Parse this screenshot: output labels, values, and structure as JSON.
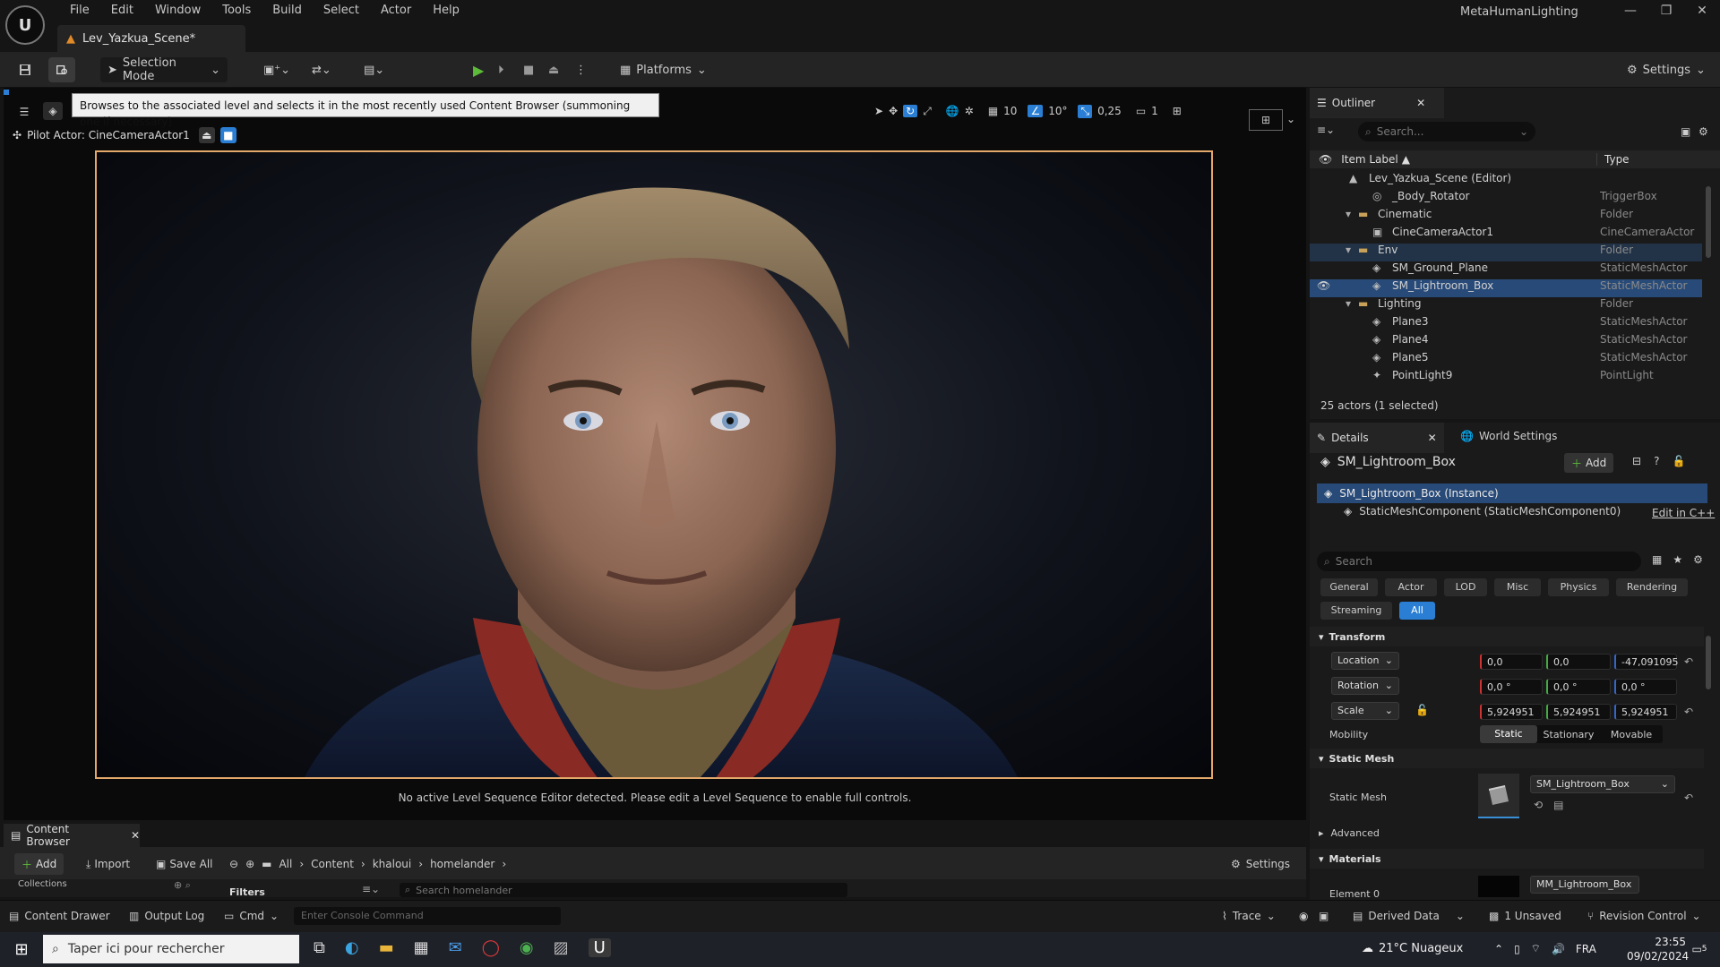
{
  "menu": [
    "File",
    "Edit",
    "Window",
    "Tools",
    "Build",
    "Select",
    "Actor",
    "Help"
  ],
  "doc_tab": "Lev_Yazkua_Scene*",
  "project_name": "MetaHumanLighting",
  "toolbar": {
    "selection_mode": "Selection Mode",
    "platforms": "Platforms",
    "settings": "Settings"
  },
  "viewport": {
    "tooltip": "Browses to the associated level and selects it in the most recently used Content Browser (summoning one if necessary)",
    "pilot_actor": "Pilot Actor: CineCameraActor1",
    "grid_snap": "10",
    "angle_snap": "10°",
    "scale_snap": "0,25",
    "camera_speed": "1",
    "sequencer_msg": "No active Level Sequence Editor detected. Please edit a Level Sequence to enable full controls."
  },
  "outliner": {
    "title": "Outliner",
    "search_placeholder": "Search...",
    "col_label": "Item Label",
    "col_type": "Type",
    "rows": [
      {
        "name": "Lev_Yazkua_Scene (Editor)",
        "type": ""
      },
      {
        "name": "_Body_Rotator",
        "type": "TriggerBox"
      },
      {
        "name": "Cinematic",
        "type": "Folder"
      },
      {
        "name": "CineCameraActor1",
        "type": "CineCameraActor"
      },
      {
        "name": "Env",
        "type": "Folder"
      },
      {
        "name": "SM_Ground_Plane",
        "type": "StaticMeshActor"
      },
      {
        "name": "SM_Lightroom_Box",
        "type": "StaticMeshActor"
      },
      {
        "name": "Lighting",
        "type": "Folder"
      },
      {
        "name": "Plane3",
        "type": "StaticMeshActor"
      },
      {
        "name": "Plane4",
        "type": "StaticMeshActor"
      },
      {
        "name": "Plane5",
        "type": "StaticMeshActor"
      },
      {
        "name": "PointLight9",
        "type": "PointLight"
      }
    ],
    "footer": "25 actors (1 selected)"
  },
  "details": {
    "tab": "Details",
    "world_tab": "World Settings",
    "actor_name": "SM_Lightroom_Box",
    "add_label": "Add",
    "instance": "SM_Lightroom_Box (Instance)",
    "component": "StaticMeshComponent (StaticMeshComponent0)",
    "edit_cpp": "Edit in C++",
    "search_placeholder": "Search",
    "filters": [
      "General",
      "Actor",
      "LOD",
      "Misc",
      "Physics",
      "Rendering",
      "Streaming",
      "All"
    ],
    "transform_header": "Transform",
    "location_label": "Location",
    "location": [
      "0,0",
      "0,0",
      "-47,091095"
    ],
    "rotation_label": "Rotation",
    "rotation": [
      "0,0 °",
      "0,0 °",
      "0,0 °"
    ],
    "scale_label": "Scale",
    "scale": [
      "5,924951",
      "5,924951",
      "5,924951"
    ],
    "mobility_label": "Mobility",
    "mobility": [
      "Static",
      "Stationary",
      "Movable"
    ],
    "static_mesh_header": "Static Mesh",
    "static_mesh_label": "Static Mesh",
    "static_mesh_value": "SM_Lightroom_Box",
    "advanced": "Advanced",
    "materials_header": "Materials",
    "element0": "Element 0",
    "material_value": "MM_Lightroom_Box"
  },
  "content_browser": {
    "tab": "Content Browser",
    "add": "Add",
    "import": "Import",
    "save_all": "Save All",
    "path": [
      "All",
      "Content",
      "khaloui",
      "homelander"
    ],
    "settings": "Settings",
    "collections": "Collections",
    "filters": "Filters",
    "search_placeholder": "Search homelander"
  },
  "statusbar": {
    "content_drawer": "Content Drawer",
    "output_log": "Output Log",
    "cmd": "Cmd",
    "console_placeholder": "Enter Console Command",
    "trace": "Trace",
    "derived_data": "Derived Data",
    "unsaved": "1 Unsaved",
    "revision_control": "Revision Control"
  },
  "taskbar": {
    "search_placeholder": "Taper ici pour rechercher",
    "weather": "21°C Nuageux",
    "lang": "FRA",
    "time": "23:55",
    "date": "09/02/2024",
    "notif_count": "5"
  },
  "colors": {
    "accent": "#2a7fd4",
    "selection": "#284a78",
    "frame": "#e3a86a",
    "x": "#c33",
    "y": "#4a4",
    "z": "#36c"
  }
}
